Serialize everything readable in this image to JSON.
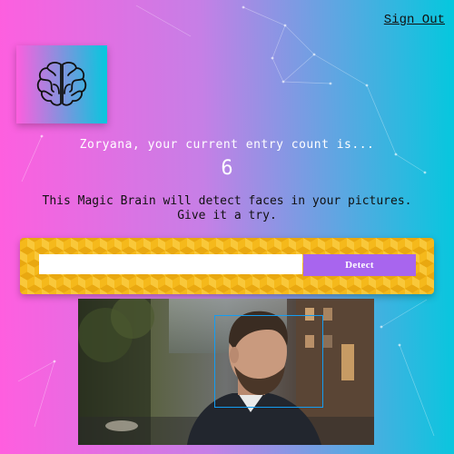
{
  "nav": {
    "sign_out": "Sign Out"
  },
  "logo": {
    "icon": "brain-icon"
  },
  "rank": {
    "greeting": "Zoryana, your current entry count is...",
    "count": "6"
  },
  "intro": {
    "line1": "This Magic Brain will detect faces in your pictures.",
    "line2": "Give it a try."
  },
  "form": {
    "input_value": "",
    "button_label": "Detect"
  },
  "colors": {
    "gradient_start": "#ff5edf",
    "gradient_end": "#04c8de",
    "button": "#a865ee",
    "form_background": "#f5b91b",
    "face_box": "#149df2"
  },
  "image": {
    "content": "man in suit on city street",
    "faces_detected": 1
  }
}
